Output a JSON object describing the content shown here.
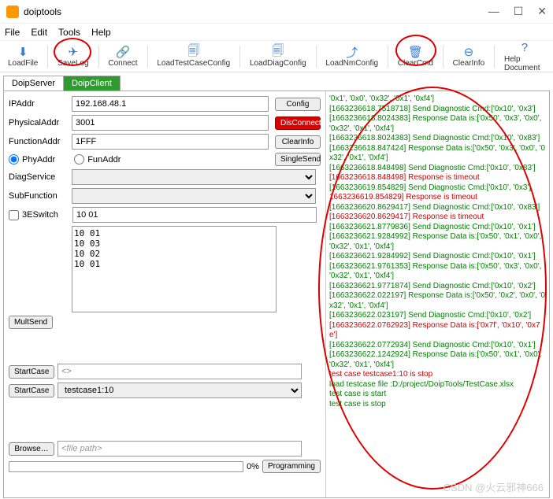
{
  "window": {
    "title": "doiptools",
    "min": "—",
    "max": "☐",
    "close": "✕"
  },
  "menu": [
    "File",
    "Edit",
    "Tools",
    "Help"
  ],
  "toolbar": [
    {
      "label": "LoadFile",
      "icon": "⬇"
    },
    {
      "label": "SaveLog",
      "icon": "✈"
    },
    {
      "label": "Connect",
      "icon": "🔗"
    },
    {
      "label": "LoadTestCaseConfig",
      "icon": "🗐"
    },
    {
      "label": "LoadDiagConfig",
      "icon": "🗐"
    },
    {
      "label": "LoadNmConfig",
      "icon": "⤴"
    },
    {
      "label": "ClearCmd",
      "icon": "🗑"
    },
    {
      "label": "ClearInfo",
      "icon": "⊖"
    },
    {
      "label": "Help Document",
      "icon": "?"
    }
  ],
  "tabs": {
    "server": "DoipServer",
    "client": "DoipClient"
  },
  "form": {
    "ipaddr_label": "IPAddr",
    "ipaddr": "192.168.48.1",
    "physaddr_label": "PhysicalAddr",
    "physaddr": "3001",
    "funcaddr_label": "FunctionAddr",
    "funcaddr": "1FFF",
    "phy_label": "PhyAddr",
    "fun_label": "FunAddr",
    "diag_label": "DiagService",
    "sub_label": "SubFunction",
    "switch_label": "3ESwitch",
    "switch_val": "10 01",
    "list_val": "10 01\n10 03\n10 02\n10 01",
    "multsend": "MultSend",
    "startcase": "StartCase",
    "case_one": "<>",
    "startcase2": "StartCase",
    "case_two": "testcase1:10",
    "browse": "Browse…",
    "filepath_ph": "<file path>",
    "pct": "0%",
    "programming": "Programming",
    "config": "Config",
    "disconnect": "DisConnect",
    "clearinfo": "ClearInfo",
    "singlesend": "SingleSend"
  },
  "log": [
    {
      "cls": "g",
      "t": "'0x1', '0x0', '0x32', '0x1', '0xf4']"
    },
    {
      "cls": "g",
      "t": "[1663236618.7518718] Send Diagnostic Cmd:['0x10', '0x3']"
    },
    {
      "cls": "g",
      "t": "[1663236618.8024383] Response Data is:['0x50', '0x3', '0x0', '0x32', '0x1', '0xf4']"
    },
    {
      "cls": "g",
      "t": "[1663236618.8024383] Send Diagnostic Cmd:['0x10', '0x83']"
    },
    {
      "cls": "g",
      "t": "[1663236618.847424] Response Data is:['0x50', '0x3', '0x0', '0x32', '0x1', '0xf4']"
    },
    {
      "cls": "g",
      "t": "[1663236618.848498] Send Diagnostic Cmd:['0x10', '0x83']"
    },
    {
      "cls": "r",
      "t": "[1663236618.848498] Response is timeout"
    },
    {
      "cls": "g",
      "t": "[1663236619.854829] Send Diagnostic Cmd:['0x10', '0x3']"
    },
    {
      "cls": "r",
      "t": "1663236619.854829] Response is timeout"
    },
    {
      "cls": "g",
      "t": "[1663236620.8629417] Send Diagnostic Cmd:['0x10', '0x83']"
    },
    {
      "cls": "r",
      "t": "[1663236620.8629417] Response is timeout"
    },
    {
      "cls": "g",
      "t": "[1663236621.8779836] Send Diagnostic Cmd:['0x10', '0x1']"
    },
    {
      "cls": "g",
      "t": "[1663236621.9284992] Response Data is:['0x50', '0x1', '0x0', '0x32', '0x1', '0xf4']"
    },
    {
      "cls": "g",
      "t": "[1663236621.9284992] Send Diagnostic Cmd:['0x10', '0x1']"
    },
    {
      "cls": "g",
      "t": "[1663236621.9761353] Response Data is:['0x50', '0x3', '0x0', '0x32', '0x1', '0xf4']"
    },
    {
      "cls": "g",
      "t": "[1663236621.9771874] Send Diagnostic Cmd:['0x10', '0x2']"
    },
    {
      "cls": "g",
      "t": "[1663236622.022197] Response Data is:['0x50', '0x2', '0x0', '0x32', '0x1', '0xf4']"
    },
    {
      "cls": "g",
      "t": "[1663236622.023197] Send Diagnostic Cmd:['0x10', '0x2']"
    },
    {
      "cls": "r",
      "t": "[1663236622.0762923] Response Data is:['0x7f', '0x10', '0x7e']"
    },
    {
      "cls": "g",
      "t": "[1663236622.0772934] Send Diagnostic Cmd:['0x10', '0x1']"
    },
    {
      "cls": "g",
      "t": "[1663236622.1242924] Response Data is:['0x50', '0x1', '0x0', '0x32', '0x1', '0xf4']"
    },
    {
      "cls": "r",
      "t": "test case testcase1:10 is stop"
    },
    {
      "cls": "g",
      "t": "load testcase file :D:/project/DoipTools/TestCase.xlsx"
    },
    {
      "cls": "g",
      "t": "test case is start"
    },
    {
      "cls": "g",
      "t": "test case is stop"
    }
  ],
  "watermark": "CSDN @火云邪神666"
}
